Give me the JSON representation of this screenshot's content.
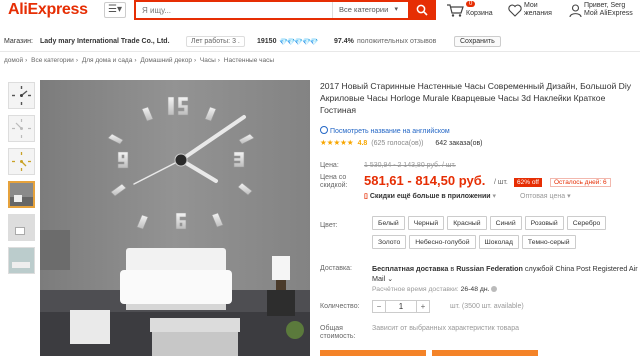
{
  "header": {
    "logo": "AliExpress",
    "search_placeholder": "Я ищу...",
    "search_category": "Все категории",
    "cart_count": "0",
    "cart_label": "Корзина",
    "wish_line1": "Мои",
    "wish_line2": "желания",
    "user_line1": "Привет, Serg",
    "user_line2": "Мой AliExpress"
  },
  "store": {
    "label": "Магазин:",
    "name": "Lady mary International Trade Co., Ltd.",
    "years": "Лет работы: 3 .",
    "score": "19150",
    "diamonds": "💎💎💎💎💎",
    "feedback_pct": "97.4%",
    "feedback_label": "положительных отзывов",
    "save_label": "Сохранить"
  },
  "breadcrumb": [
    "домой",
    "Все категории",
    "Для дома и сада",
    "Домашний декор",
    "Часы",
    "Настенные часы"
  ],
  "product": {
    "title": "2017 Новый Старинные Настенные Часы Современный Дизайн, Большой Diy Акриловые Часы Horloge Murale Кварцевые Часы 3d Наклейки Краткое Гостиная",
    "translate_link": "Посмотреть название на английском",
    "stars": "★★★★★",
    "rating": "4.8",
    "votes": "(625 голоса(ов))",
    "orders": "642 заказа(ов)"
  },
  "price": {
    "price_label": "Цена:",
    "old_price": "1 530,94 - 2 143,80 руб. / шт.",
    "discount_label_1": "Цена со",
    "discount_label_2": "скидкой:",
    "current": "581,61 - 814,50 руб.",
    "unit": "/ шт.",
    "discount": "62% off",
    "days_left": "Осталось дней: 6",
    "app_discount": "Скидки ещё больше в приложении",
    "wholesale": "Оптовая цена"
  },
  "color": {
    "label": "Цвет:",
    "options": [
      "Белый",
      "Черный",
      "Красный",
      "Синий",
      "Розовый",
      "Серебро",
      "Золото",
      "Небесно-голубой",
      "Шоколад",
      "Темно-серый"
    ]
  },
  "delivery": {
    "label": "Доставка:",
    "text_bold": "Бесплатная доставка",
    "text_mid": " в ",
    "country": "Russian Federation",
    "text_via": " службой ",
    "carrier": "China Post Registered Air Mail",
    "time_label": "Расчётное время доставки:",
    "time_value": "26-48 дн."
  },
  "quantity": {
    "label": "Количество:",
    "value": "1",
    "minus": "−",
    "plus": "+",
    "stock": "шт. (3500 шт. available)"
  },
  "total": {
    "label_1": "Общая",
    "label_2": "стоимость:",
    "note": "Зависит от выбранных характеристик товара"
  },
  "clock": {
    "numbers": [
      "12",
      "3",
      "6",
      "9"
    ]
  },
  "colors": {
    "brand": "#e62e04",
    "accent_orange": "#f48328",
    "link_blue": "#2467c6",
    "star": "#f7a600"
  }
}
